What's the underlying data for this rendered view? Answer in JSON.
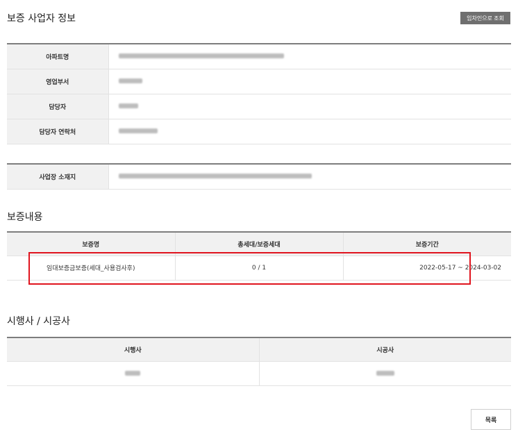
{
  "page": {
    "title": "보증 사업자 정보",
    "lookup_button": "임차인으로 조회"
  },
  "info_table": {
    "rows": [
      {
        "label": "아파트명"
      },
      {
        "label": "영업부서"
      },
      {
        "label": "담당자"
      },
      {
        "label": "담당자 연락처"
      }
    ]
  },
  "location_table": {
    "label": "사업장 소재지"
  },
  "guarantee": {
    "section_title": "보증내용",
    "headers": [
      "보증명",
      "총세대/보증세대",
      "보증기간"
    ],
    "row": {
      "name": "임대보증금보증(세대_사용검사후)",
      "units": "0 / 1",
      "period": "2022-05-17 ~ 2024-03-02"
    },
    "highlight_color": "#e0141e"
  },
  "contractors": {
    "section_title": "시행사 / 시공사",
    "headers": [
      "시행사",
      "시공사"
    ]
  },
  "footer": {
    "list_button": "목록"
  }
}
